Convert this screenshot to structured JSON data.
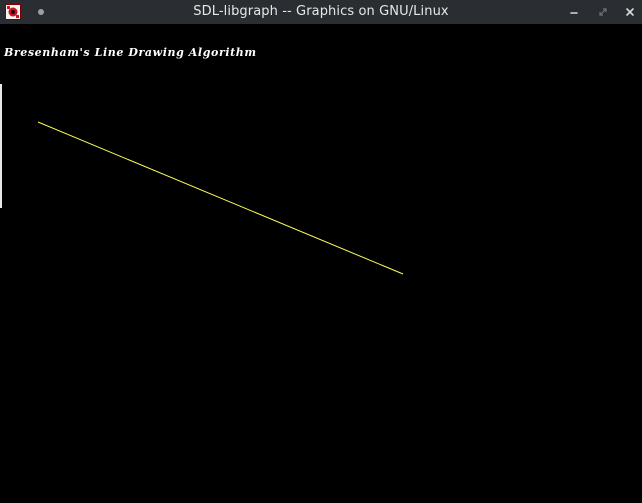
{
  "window": {
    "title": "SDL-libgraph -- Graphics on GNU/Linux",
    "controls": {
      "minimize_icon": "minimize-icon",
      "maximize_icon": "restore-icon",
      "close_icon": "close-icon"
    }
  },
  "canvas": {
    "background": "#000000",
    "heading": "Bresenham's Line Drawing Algorithm",
    "heading_color": "#ffffff",
    "line_color": "#ffff55"
  }
}
